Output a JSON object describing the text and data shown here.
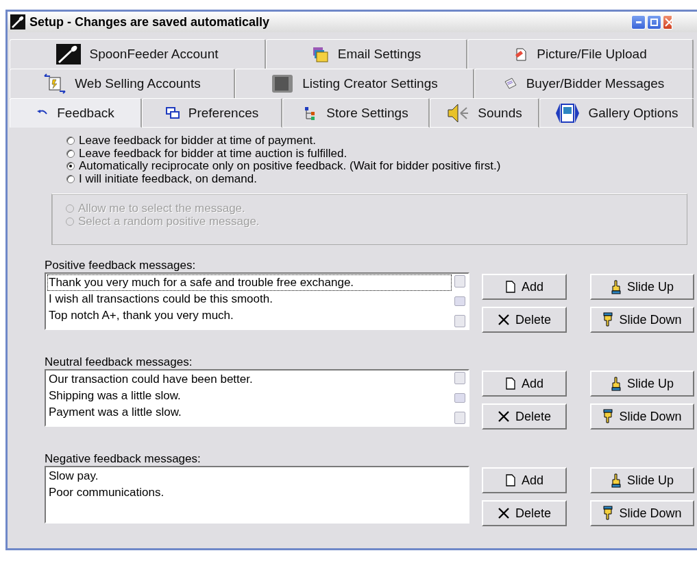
{
  "window": {
    "title": "Setup - Changes are saved automatically"
  },
  "tab_rows": [
    [
      {
        "label": "SpoonFeeder Account",
        "selected": false
      },
      {
        "label": "Email Settings",
        "selected": false
      },
      {
        "label": "Picture/File Upload",
        "selected": false
      }
    ],
    [
      {
        "label": "Web Selling Accounts",
        "selected": false
      },
      {
        "label": "Listing Creator Settings",
        "selected": false
      },
      {
        "label": "Buyer/Bidder Messages",
        "selected": false
      }
    ],
    [
      {
        "label": "Feedback",
        "selected": true
      },
      {
        "label": "Preferences",
        "selected": false
      },
      {
        "label": "Store Settings",
        "selected": false
      },
      {
        "label": "Sounds",
        "selected": false
      },
      {
        "label": "Gallery Options",
        "selected": false
      }
    ]
  ],
  "feedback_options": [
    {
      "label": "Leave feedback for bidder at time of payment.",
      "selected": false
    },
    {
      "label": "Leave feedback for bidder at time auction is fulfilled.",
      "selected": false
    },
    {
      "label": "Automatically reciprocate only on positive feedback. (Wait for bidder positive first.)",
      "selected": true
    },
    {
      "label": "I will initiate feedback, on demand.",
      "selected": false
    }
  ],
  "message_options": [
    {
      "label": "Allow me to select the message.",
      "selected": false,
      "disabled": true
    },
    {
      "label": "Select a random positive message.",
      "selected": false,
      "disabled": true
    }
  ],
  "message_lists": [
    {
      "label": "Positive feedback messages:",
      "scrollable": true,
      "items": [
        {
          "text": "Thank you very much for a safe and trouble free exchange.",
          "focused": true
        },
        {
          "text": "I wish all transactions could be this smooth.",
          "focused": false
        },
        {
          "text": "Top notch A+, thank you very much.",
          "focused": false
        }
      ],
      "buttons": [
        {
          "label": "Add",
          "kind": "add"
        },
        {
          "label": "Slide Up",
          "kind": "up"
        },
        {
          "label": "Delete",
          "kind": "delete"
        },
        {
          "label": "Slide Down",
          "kind": "down"
        }
      ]
    },
    {
      "label": "Neutral feedback messages:",
      "scrollable": true,
      "items": [
        {
          "text": "Our transaction could have been better.",
          "focused": false
        },
        {
          "text": "Shipping was a little slow.",
          "focused": false
        },
        {
          "text": "Payment was a little slow.",
          "focused": false
        }
      ],
      "buttons": [
        {
          "label": "Add",
          "kind": "add"
        },
        {
          "label": "Slide Up",
          "kind": "up"
        },
        {
          "label": "Delete",
          "kind": "delete"
        },
        {
          "label": "Slide Down",
          "kind": "down"
        }
      ]
    },
    {
      "label": "Negative feedback messages:",
      "scrollable": false,
      "items": [
        {
          "text": "Slow pay.",
          "focused": false
        },
        {
          "text": "Poor communications.",
          "focused": false
        }
      ],
      "buttons": [
        {
          "label": "Add",
          "kind": "add"
        },
        {
          "label": "Slide Up",
          "kind": "up"
        },
        {
          "label": "Delete",
          "kind": "delete"
        },
        {
          "label": "Slide Down",
          "kind": "down"
        }
      ]
    }
  ]
}
